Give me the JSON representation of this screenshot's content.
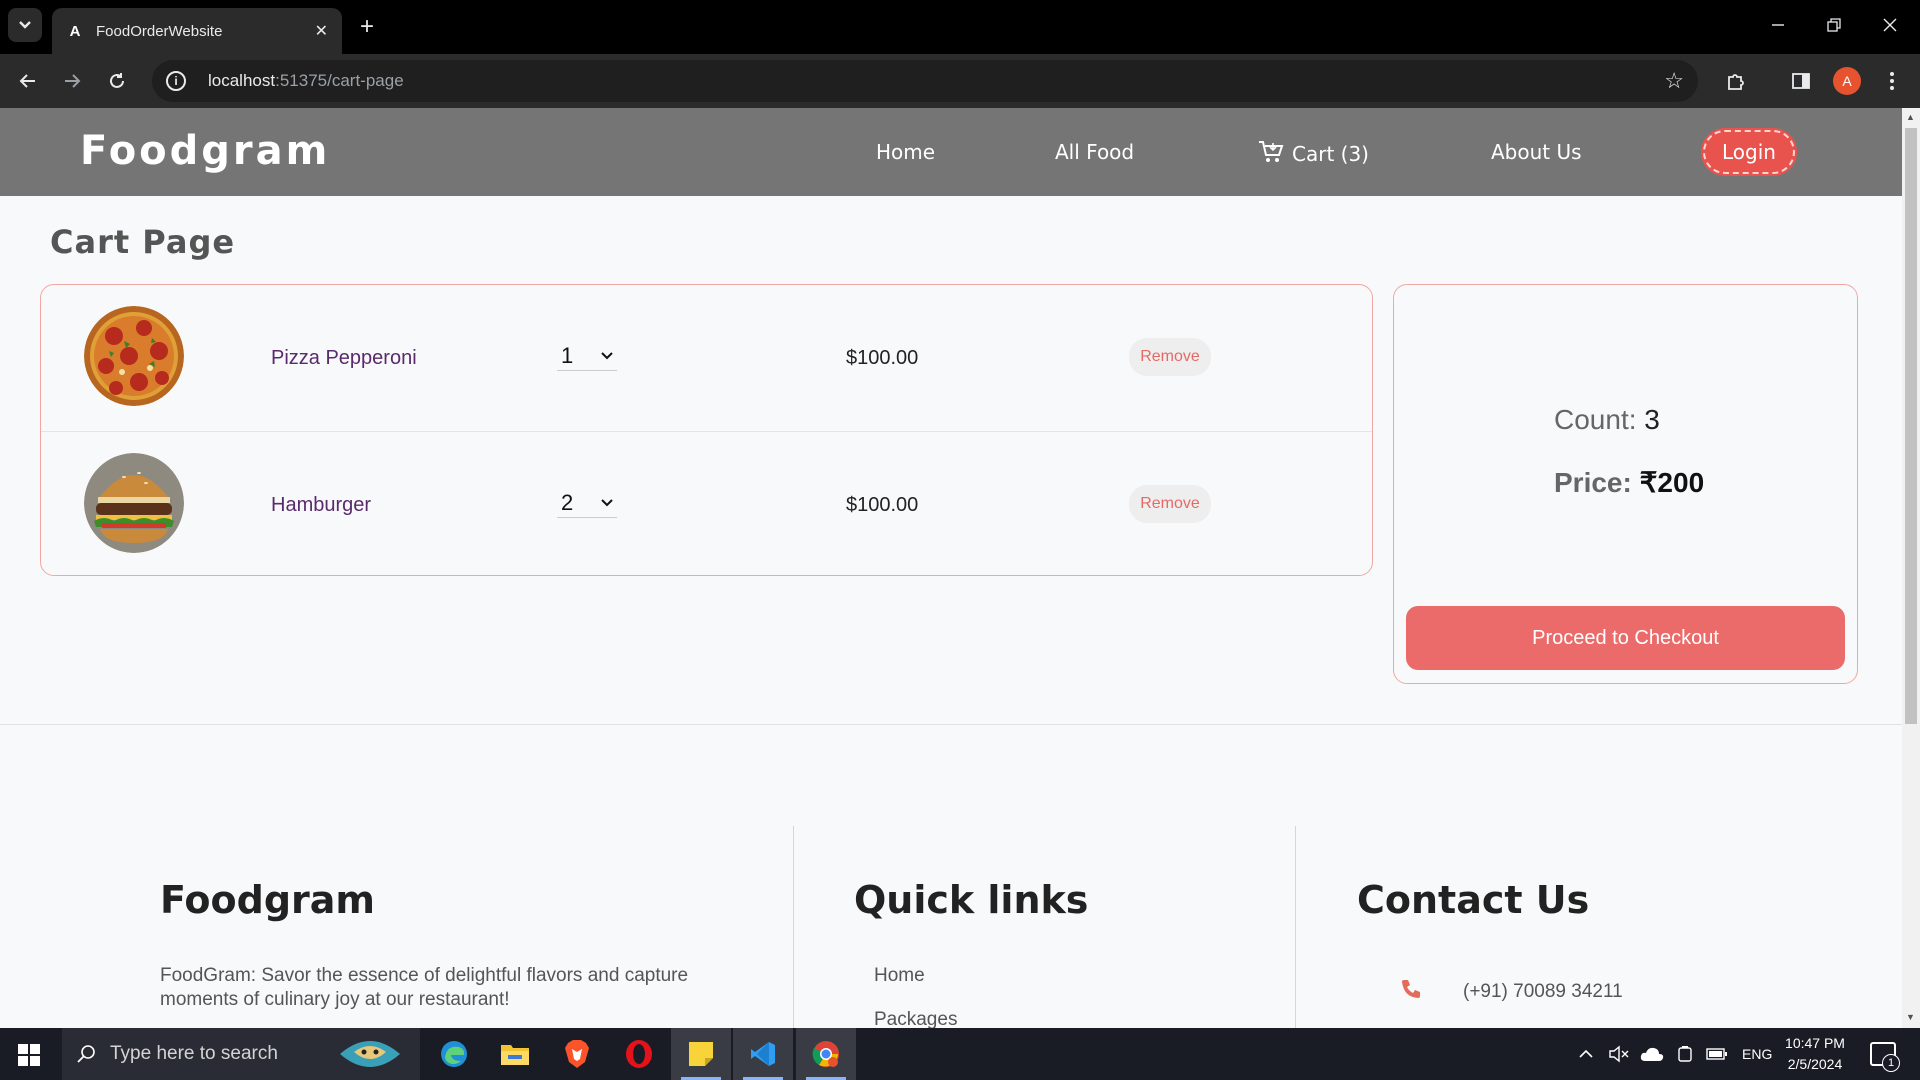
{
  "browser": {
    "tab_title": "FoodOrderWebsite",
    "url_host": "localhost",
    "url_rest": ":51375/cart-page"
  },
  "site": {
    "brand": "Foodgram",
    "nav": {
      "home": "Home",
      "all_food": "All Food",
      "cart": "Cart (3)",
      "about": "About Us",
      "login": "Login"
    }
  },
  "page_title": "Cart Page",
  "cart": {
    "items": [
      {
        "name": "Pizza Pepperoni",
        "quantity": "1",
        "price": "$100.00",
        "remove_label": "Remove",
        "image": "pizza"
      },
      {
        "name": "Hamburger",
        "quantity": "2",
        "price": "$100.00",
        "remove_label": "Remove",
        "image": "hamburger"
      }
    ]
  },
  "summary": {
    "count_label": "Count:",
    "count_value": "3",
    "price_label": "Price:",
    "price_value": "₹200",
    "checkout_label": "Proceed to Checkout"
  },
  "footer": {
    "brand_heading": "Foodgram",
    "description": "FoodGram: Savor the essence of delightful flavors and capture moments of culinary joy at our restaurant!",
    "quick_links_heading": "Quick links",
    "quick_links": [
      "Home",
      "Packages"
    ],
    "contact_heading": "Contact Us",
    "phone": "(+91) 70089 34211"
  },
  "taskbar": {
    "search_placeholder": "Type here to search",
    "language": "ENG",
    "time": "10:47 PM",
    "date": "2/5/2024",
    "notification_count": "1"
  },
  "colors": {
    "accent": "#ea6b69",
    "header_bg": "#757575",
    "item_name": "#5a2a6d"
  }
}
